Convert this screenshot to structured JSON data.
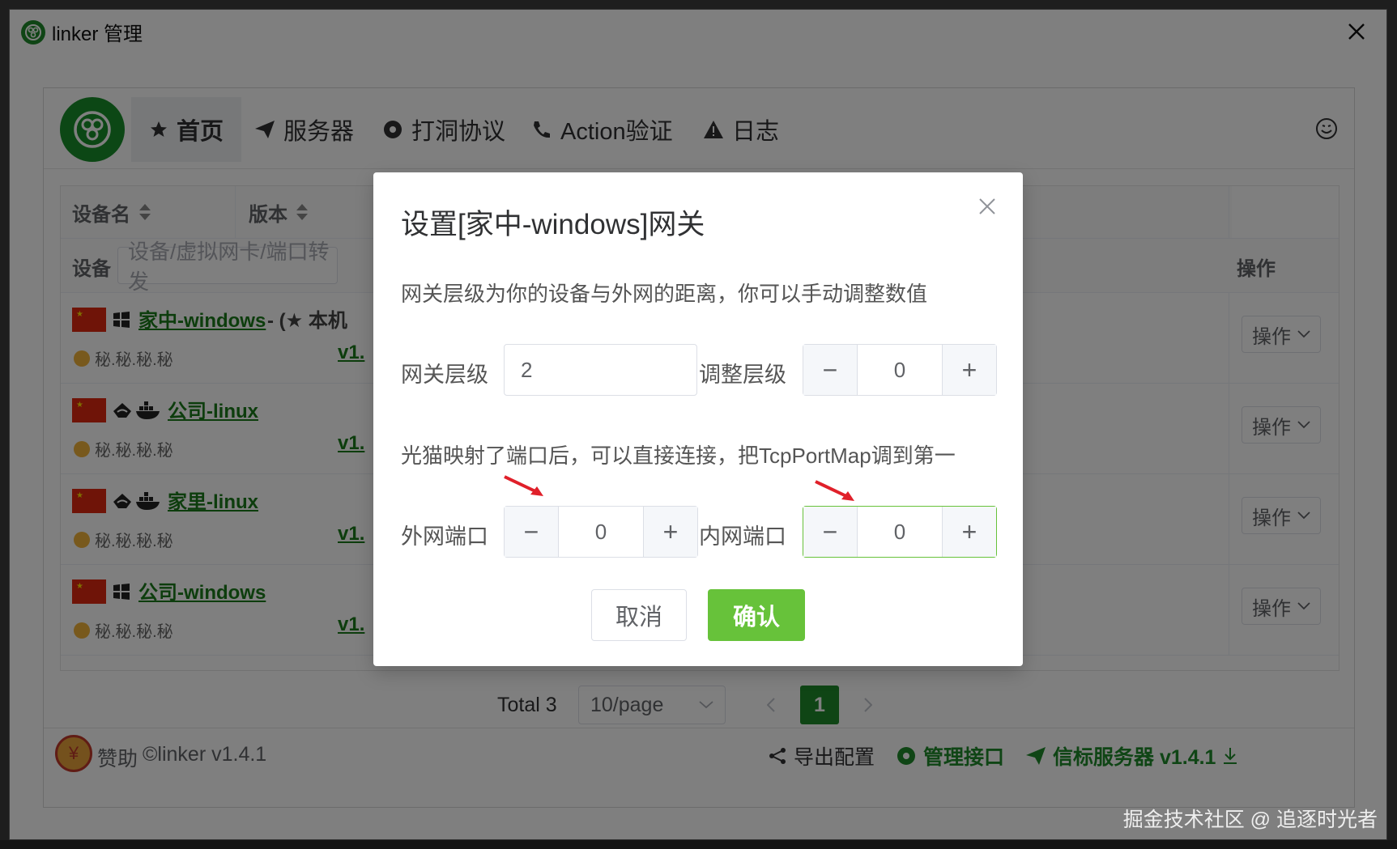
{
  "window": {
    "title": "linker 管理"
  },
  "nav": {
    "items": [
      {
        "label": "首页",
        "icon": "star-icon"
      },
      {
        "label": "服务器",
        "icon": "send-icon"
      },
      {
        "label": "打洞协议",
        "icon": "gear-icon"
      },
      {
        "label": "Action验证",
        "icon": "phone-icon"
      },
      {
        "label": "日志",
        "icon": "warning-icon"
      }
    ]
  },
  "table": {
    "headers": {
      "device_name": "设备名",
      "version": "版本",
      "operation": "操作"
    },
    "filter": {
      "label": "设备",
      "placeholder": "设备/虚拟网卡/端口转发"
    },
    "rows": [
      {
        "name": "家中-windows",
        "suffix": "- (★ 本机",
        "ip": "秘.秘.秘.秘",
        "version": "v1.",
        "op": "操作"
      },
      {
        "name": "公司-linux",
        "ip": "秘.秘.秘.秘",
        "version": "v1.",
        "op": "操作"
      },
      {
        "name": "家里-linux",
        "ip": "秘.秘.秘.秘",
        "version": "v1.",
        "op": "操作"
      },
      {
        "name": "公司-windows",
        "ip": "秘.秘.秘.秘",
        "version": "v1.",
        "op": "操作"
      }
    ]
  },
  "pager": {
    "total": "Total 3",
    "page_size": "10/page",
    "current": "1"
  },
  "footer": {
    "sponsor": "赞助",
    "copyright": "©linker v1.4.1",
    "export": "导出配置",
    "manage": "管理接口",
    "server": "信标服务器 v1.4.1"
  },
  "dialog": {
    "title": "设置[家中-windows]网关",
    "desc": "网关层级为你的设备与外网的距离，你可以手动调整数值",
    "gateway_level_label": "网关层级",
    "gateway_level_value": "2",
    "adjust_level_label": "调整层级",
    "adjust_level_value": "0",
    "hint": "光猫映射了端口后，可以直接连接，把TcpPortMap调到第一",
    "wan_port_label": "外网端口",
    "wan_port_value": "0",
    "lan_port_label": "内网端口",
    "lan_port_value": "0",
    "cancel": "取消",
    "confirm": "确认"
  },
  "watermark": "掘金技术社区 @ 追逐时光者",
  "colors": {
    "accent": "#67c23a",
    "brand": "#1f8a2a",
    "link": "#1a7a1a"
  }
}
